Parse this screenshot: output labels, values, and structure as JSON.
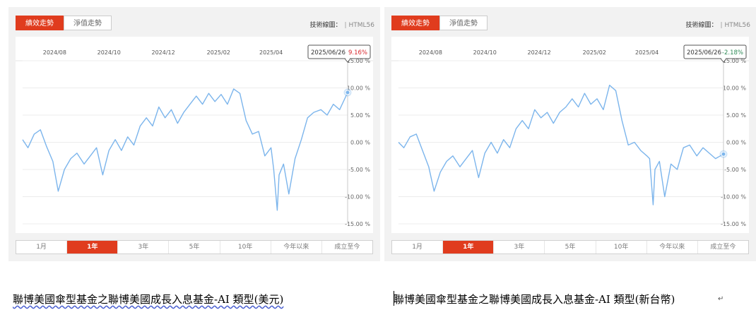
{
  "panels": [
    {
      "tabs": {
        "performance": "績效走勢",
        "nav": "淨值走勢"
      },
      "tech_label": "技術線圖：",
      "tech_engine": "HTML56",
      "tooltip": {
        "date": "2025/06/26",
        "value": "9.16%",
        "color": "#d9262c"
      },
      "ranges": [
        "1月",
        "1年",
        "3年",
        "5年",
        "10年",
        "今年以來",
        "成立至今"
      ],
      "active_range": "1年",
      "caption": "聯博美國傘型基金之聯博美國成長入息基金-AI 類型(美元)"
    },
    {
      "tabs": {
        "performance": "績效走勢",
        "nav": "淨值走勢"
      },
      "tech_label": "技術線圖：",
      "tech_engine": "HTML56",
      "tooltip": {
        "date": "2025/06/26",
        "value": "-2.18%",
        "color": "#2e8b57"
      },
      "ranges": [
        "1月",
        "1年",
        "3年",
        "5年",
        "10年",
        "今年以來",
        "成立至今"
      ],
      "active_range": "1年",
      "caption": "聯博美國傘型基金之聯博美國成長入息基金-AI 類型(新台幣)"
    }
  ],
  "colors": {
    "accent": "#e03c1e",
    "line": "#7cb5ec"
  },
  "chart_data": [
    {
      "type": "line",
      "x_ticks": [
        "2024/08",
        "2024/10",
        "2024/12",
        "2025/02",
        "2025/04"
      ],
      "y_ticks": [
        "15.00 %",
        "10.00 %",
        "5.00 %",
        "0.00 %",
        "-5.00 %",
        "-10.00 %",
        "-15.00 %"
      ],
      "ylim": [
        -15,
        15
      ],
      "xlim": [
        "2024/06/26",
        "2025/06/26"
      ],
      "grid": true,
      "series": [
        {
          "x": [
            "2024/06/26",
            "2024/07/02",
            "2024/07/09",
            "2024/07/16",
            "2024/07/23",
            "2024/07/30",
            "2024/08/05",
            "2024/08/12",
            "2024/08/19",
            "2024/08/26",
            "2024/09/03",
            "2024/09/10",
            "2024/09/17",
            "2024/09/24",
            "2024/10/01",
            "2024/10/08",
            "2024/10/15",
            "2024/10/22",
            "2024/10/29",
            "2024/11/05",
            "2024/11/12",
            "2024/11/19",
            "2024/11/26",
            "2024/12/03",
            "2024/12/10",
            "2024/12/17",
            "2024/12/24",
            "2024/12/31",
            "2025/01/07",
            "2025/01/14",
            "2025/01/21",
            "2025/01/28",
            "2025/02/04",
            "2025/02/11",
            "2025/02/18",
            "2025/02/25",
            "2025/03/04",
            "2025/03/11",
            "2025/03/18",
            "2025/03/25",
            "2025/04/01",
            "2025/04/04",
            "2025/04/08",
            "2025/04/10",
            "2025/04/15",
            "2025/04/21",
            "2025/04/28",
            "2025/05/05",
            "2025/05/12",
            "2025/05/19",
            "2025/05/27",
            "2025/06/03",
            "2025/06/10",
            "2025/06/17",
            "2025/06/26"
          ],
          "values": [
            0.5,
            -1.0,
            1.5,
            2.3,
            -0.8,
            -3.5,
            -9.0,
            -5.0,
            -3.0,
            -2.0,
            -4.0,
            -2.5,
            -1.0,
            -6.0,
            -1.5,
            0.5,
            -1.5,
            1.0,
            -0.5,
            3.0,
            4.5,
            3.0,
            6.5,
            4.5,
            6.0,
            3.5,
            5.5,
            7.0,
            8.5,
            7.0,
            9.0,
            7.5,
            8.8,
            7.0,
            9.8,
            9.0,
            4.0,
            1.5,
            2.0,
            -2.5,
            -1.0,
            -5.0,
            -12.5,
            -6.0,
            -4.0,
            -9.5,
            -3.0,
            0.5,
            4.5,
            5.5,
            6.0,
            5.0,
            7.0,
            6.0,
            9.16
          ]
        }
      ]
    },
    {
      "type": "line",
      "x_ticks": [
        "2024/08",
        "2024/10",
        "2024/12",
        "2025/02",
        "2025/04"
      ],
      "y_ticks": [
        "15.00 %",
        "10.00 %",
        "5.00 %",
        "0.00 %",
        "-5.00 %",
        "-10.00 %",
        "-15.00 %"
      ],
      "ylim": [
        -15,
        15
      ],
      "xlim": [
        "2024/06/26",
        "2025/06/26"
      ],
      "grid": true,
      "series": [
        {
          "x": [
            "2024/06/26",
            "2024/07/02",
            "2024/07/09",
            "2024/07/16",
            "2024/07/23",
            "2024/07/30",
            "2024/08/05",
            "2024/08/12",
            "2024/08/19",
            "2024/08/26",
            "2024/09/03",
            "2024/09/10",
            "2024/09/17",
            "2024/09/24",
            "2024/10/01",
            "2024/10/08",
            "2024/10/15",
            "2024/10/22",
            "2024/10/29",
            "2024/11/05",
            "2024/11/12",
            "2024/11/19",
            "2024/11/26",
            "2024/12/03",
            "2024/12/10",
            "2024/12/17",
            "2024/12/24",
            "2024/12/31",
            "2025/01/07",
            "2025/01/14",
            "2025/01/21",
            "2025/01/28",
            "2025/02/04",
            "2025/02/11",
            "2025/02/18",
            "2025/02/25",
            "2025/03/04",
            "2025/03/11",
            "2025/03/18",
            "2025/03/25",
            "2025/04/01",
            "2025/04/04",
            "2025/04/08",
            "2025/04/10",
            "2025/04/15",
            "2025/04/21",
            "2025/04/28",
            "2025/05/05",
            "2025/05/12",
            "2025/05/19",
            "2025/05/27",
            "2025/06/03",
            "2025/06/10",
            "2025/06/17",
            "2025/06/26"
          ],
          "values": [
            0.0,
            -1.0,
            1.0,
            1.5,
            -1.5,
            -4.5,
            -9.0,
            -5.5,
            -3.5,
            -2.5,
            -4.5,
            -3.0,
            -1.5,
            -6.5,
            -2.0,
            0.0,
            -2.0,
            0.5,
            -1.0,
            2.5,
            4.0,
            2.5,
            6.0,
            4.5,
            5.5,
            3.5,
            5.5,
            6.5,
            8.0,
            6.5,
            9.0,
            7.0,
            8.0,
            6.0,
            10.5,
            9.5,
            4.0,
            -0.5,
            0.0,
            -1.5,
            -2.5,
            -3.0,
            -11.5,
            -5.0,
            -3.5,
            -10.0,
            -4.0,
            -5.0,
            -1.0,
            -0.5,
            -2.5,
            -1.0,
            -2.0,
            -3.0,
            -2.18
          ]
        }
      ]
    }
  ]
}
